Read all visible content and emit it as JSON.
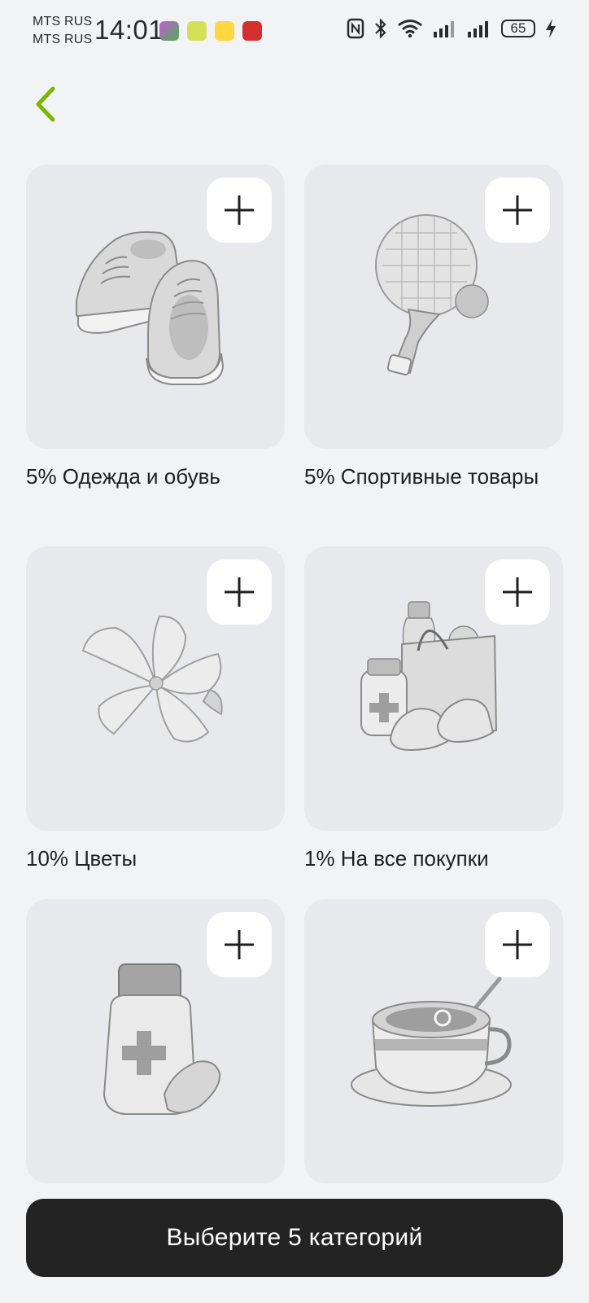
{
  "status_bar": {
    "carrier_1": "MTS RUS",
    "carrier_2": "MTS RUS",
    "time": "14:01",
    "battery": "65"
  },
  "categories": [
    {
      "label": "5% Одежда и обувь",
      "icon": "sneakers-icon"
    },
    {
      "label": "5% Спортивные товары",
      "icon": "ping-pong-icon"
    },
    {
      "label": "10% Цветы",
      "icon": "flower-icon"
    },
    {
      "label": "1% На все покупки",
      "icon": "shopping-bag-icon"
    },
    {
      "label": "",
      "icon": "medicine-bottle-icon"
    },
    {
      "label": "",
      "icon": "coffee-cup-icon"
    }
  ],
  "cta": {
    "label": "Выберите 5 категорий"
  },
  "colors": {
    "accent": "#7ab800",
    "background": "#f2f3f5",
    "card": "#e8e9ec",
    "button_dark": "#232323"
  }
}
